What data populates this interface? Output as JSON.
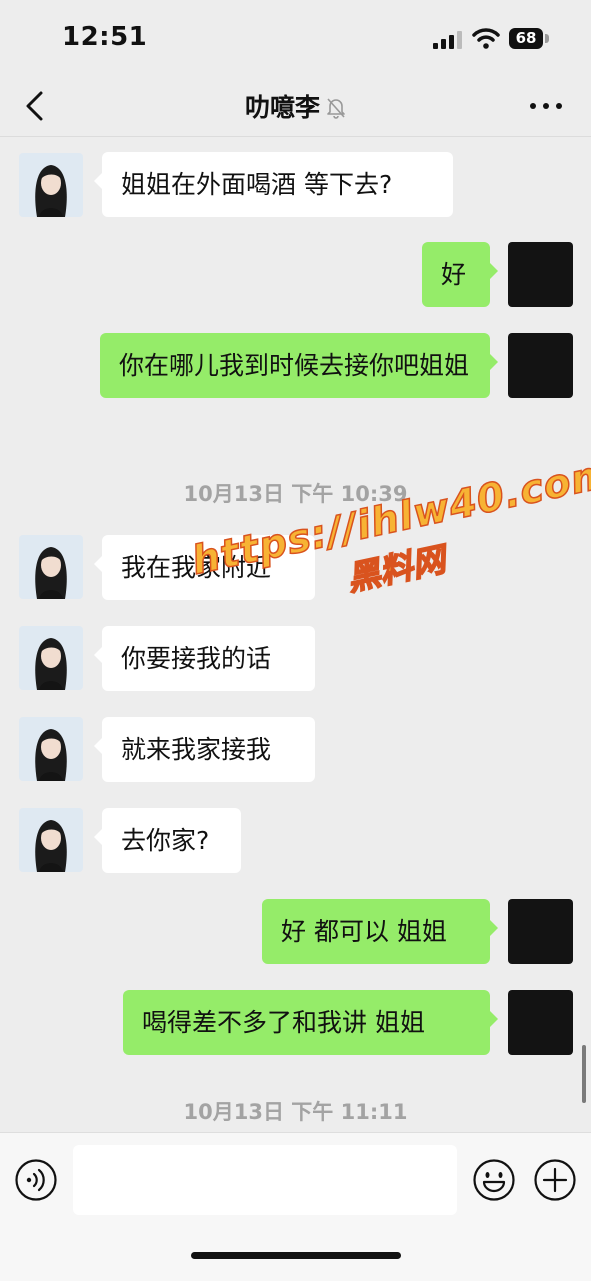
{
  "status_bar": {
    "time": "12:51",
    "battery": "68"
  },
  "nav": {
    "title": "叻噫李",
    "muted": true
  },
  "messages": [
    {
      "side": "in",
      "text": "姐姐在外面喝酒 等下去?"
    },
    {
      "side": "out",
      "text": "好"
    },
    {
      "side": "out",
      "text": "你在哪儿我到时候去接你吧姐姐"
    },
    {
      "type": "time",
      "text": "10月13日 下午 10:39"
    },
    {
      "side": "in",
      "text": "我在我家附近"
    },
    {
      "side": "in",
      "text": "你要接我的话"
    },
    {
      "side": "in",
      "text": "就来我家接我"
    },
    {
      "side": "in",
      "text": "去你家?"
    },
    {
      "side": "out",
      "text": "好 都可以 姐姐"
    },
    {
      "side": "out",
      "text": "喝得差不多了和我讲 姐姐"
    },
    {
      "type": "time",
      "text": "10月13日 下午 11:11"
    }
  ],
  "watermark": {
    "line1": "https://ihlw40.com",
    "line2": "黑料网"
  },
  "input": {
    "value": ""
  },
  "colors": {
    "outgoing_bubble": "#95ec69",
    "incoming_bubble": "#ffffff",
    "background": "#ededed"
  },
  "icons": [
    "back-icon",
    "mute-bell-icon",
    "more-icon",
    "voice-icon",
    "emoji-icon",
    "plus-icon"
  ]
}
